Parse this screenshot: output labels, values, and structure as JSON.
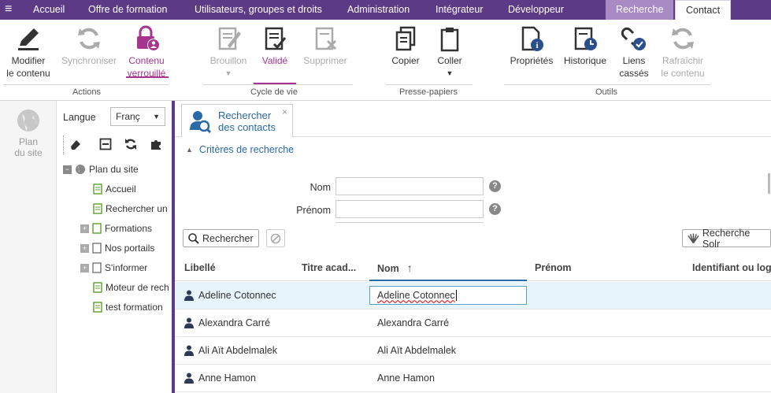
{
  "menu": {
    "hamburger": "≡",
    "items": [
      "Accueil",
      "Offre de formation",
      "Utilisateurs, groupes et droits",
      "Administration",
      "Intégrateur",
      "Développeur"
    ],
    "search_tab": "Recherche",
    "contact_tab": "Contact"
  },
  "ribbon": {
    "buttons": {
      "modify": [
        "Modifier",
        "le contenu"
      ],
      "sync": "Synchroniser",
      "locked": [
        "Contenu",
        "verrouillé"
      ],
      "draft": "Brouillon",
      "validated": "Validé",
      "delete": "Supprimer",
      "copy": "Copier",
      "paste": "Coller",
      "properties": "Propriétés",
      "history": "Historique",
      "broken_links": [
        "Liens",
        "cassés"
      ],
      "refresh": [
        "Rafraîchir",
        "le contenu"
      ]
    },
    "groups": {
      "actions": "Actions",
      "lifecycle": "Cycle de vie",
      "clipboard": "Presse-papiers",
      "tools": "Outils"
    }
  },
  "left": {
    "sitemap_label": [
      "Plan",
      "du site"
    ]
  },
  "tree": {
    "language_label": "Langue",
    "language_value": "Franç",
    "root": "Plan du site",
    "nodes": [
      "Accueil",
      "Rechercher un",
      "Formations",
      "Nos portails",
      "S'informer",
      "Moteur de rech",
      "test formation"
    ]
  },
  "tab": {
    "title": [
      "Rechercher",
      "des contacts"
    ],
    "close": "×"
  },
  "criteria": {
    "toggle": "Critères de recherche",
    "nom_label": "Nom",
    "prenom_label": "Prénom",
    "help": "?"
  },
  "actions": {
    "search": "Rechercher",
    "solr": "Recherche Solr"
  },
  "table": {
    "headers": [
      "Libellé",
      "Titre acad...",
      "Nom",
      "Prénom",
      "Identifiant ou log"
    ],
    "sort_arrow": "↑",
    "rows": [
      {
        "libelle": "Adeline Cotonnec",
        "nom": "Adeline Cotonnec",
        "editing": true
      },
      {
        "libelle": "Alexandra Carré",
        "nom": "Alexandra Carré",
        "editing": false
      },
      {
        "libelle": "Ali Aït Abdelmalek",
        "nom": "Ali Aït Abdelmalek",
        "editing": false
      },
      {
        "libelle": "Anne Hamon",
        "nom": "Anne Hamon",
        "editing": false
      }
    ]
  },
  "colors": {
    "brand": "#5d3a86",
    "accent": "#a5358e",
    "link": "#2a6aa8",
    "selected_row": "#e8f4fb"
  }
}
